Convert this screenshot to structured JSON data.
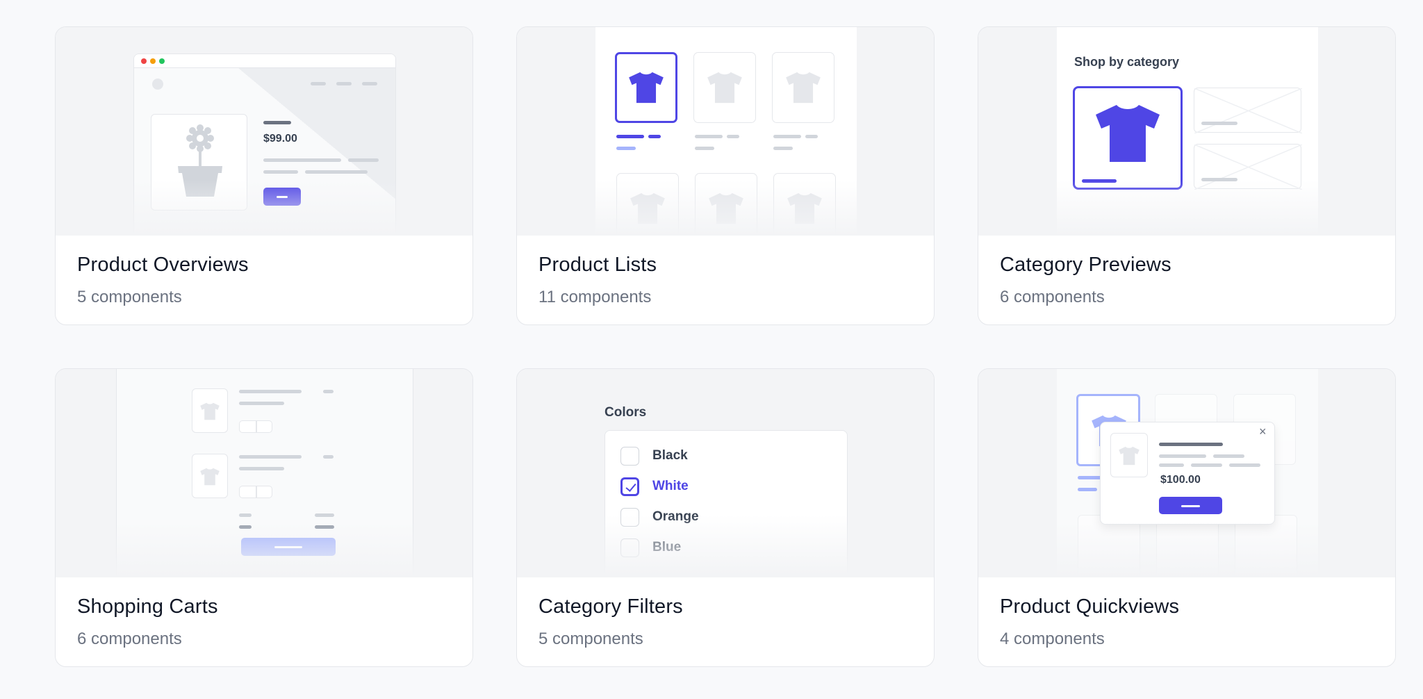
{
  "cards": [
    {
      "title": "Product Overviews",
      "count": "5 components",
      "preview": {
        "price": "$99.00"
      }
    },
    {
      "title": "Product Lists",
      "count": "11 components"
    },
    {
      "title": "Category Previews",
      "count": "6 components",
      "preview": {
        "heading": "Shop by category"
      }
    },
    {
      "title": "Shopping Carts",
      "count": "6 components"
    },
    {
      "title": "Category Filters",
      "count": "5 components",
      "preview": {
        "heading": "Colors",
        "options": [
          {
            "label": "Black",
            "checked": false
          },
          {
            "label": "White",
            "checked": true
          },
          {
            "label": "Orange",
            "checked": false
          },
          {
            "label": "Blue",
            "checked": false
          }
        ]
      }
    },
    {
      "title": "Product Quickviews",
      "count": "4 components",
      "preview": {
        "price": "$100.00",
        "close": "×"
      }
    }
  ],
  "colors": {
    "accent": "#4f46e5",
    "accent_light": "#a5b4fc",
    "border": "#e5e7eb",
    "muted": "#d1d5db",
    "bg": "#f8f9fb"
  },
  "icons": [
    "tshirt-icon",
    "plant-pot-icon",
    "checkmark-icon",
    "close-icon",
    "image-placeholder-icon"
  ]
}
